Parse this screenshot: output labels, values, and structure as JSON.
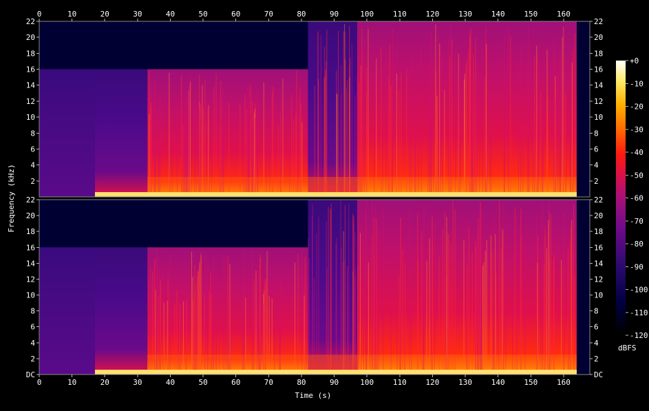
{
  "chart_data": {
    "type": "heatmap",
    "xlabel": "Time (s)",
    "ylabel": "Frequency (kHz)",
    "x_ticks": [
      "0",
      "10",
      "20",
      "30",
      "40",
      "50",
      "60",
      "70",
      "80",
      "90",
      "100",
      "110",
      "120",
      "130",
      "140",
      "150",
      "160"
    ],
    "xlim": [
      0,
      168
    ],
    "channels": [
      {
        "freq_ticks": [
          "22",
          "20",
          "18",
          "16",
          "14",
          "12",
          "10",
          "8",
          "6",
          "4",
          "2"
        ],
        "ylim": [
          0,
          22
        ]
      },
      {
        "freq_ticks": [
          "22",
          "20",
          "18",
          "16",
          "14",
          "12",
          "10",
          "8",
          "6",
          "4",
          "2",
          "DC"
        ],
        "ylim": [
          0,
          22
        ]
      }
    ],
    "colorbar": {
      "label": "dBFS",
      "ticks": [
        "+0",
        "-10",
        "-20",
        "-30",
        "-40",
        "-50",
        "-60",
        "-70",
        "-80",
        "-90",
        "-100",
        "-110",
        "-120"
      ],
      "range": [
        -120,
        0
      ]
    },
    "segments": [
      {
        "start": 0,
        "end": 17,
        "cutoff_khz": 16,
        "level_dbfs": -95
      },
      {
        "start": 17,
        "end": 33,
        "cutoff_khz": 16,
        "level_dbfs": -85
      },
      {
        "start": 33,
        "end": 82,
        "cutoff_khz": 16,
        "level_dbfs": -58
      },
      {
        "start": 82,
        "end": 97,
        "cutoff_khz": 22,
        "level_dbfs": -80
      },
      {
        "start": 97,
        "end": 164,
        "cutoff_khz": 22,
        "level_dbfs": -55
      }
    ],
    "colors": {
      "bg": "#000000",
      "low": "#000033",
      "mid": "#cc0033",
      "high": "#ffffff"
    }
  }
}
